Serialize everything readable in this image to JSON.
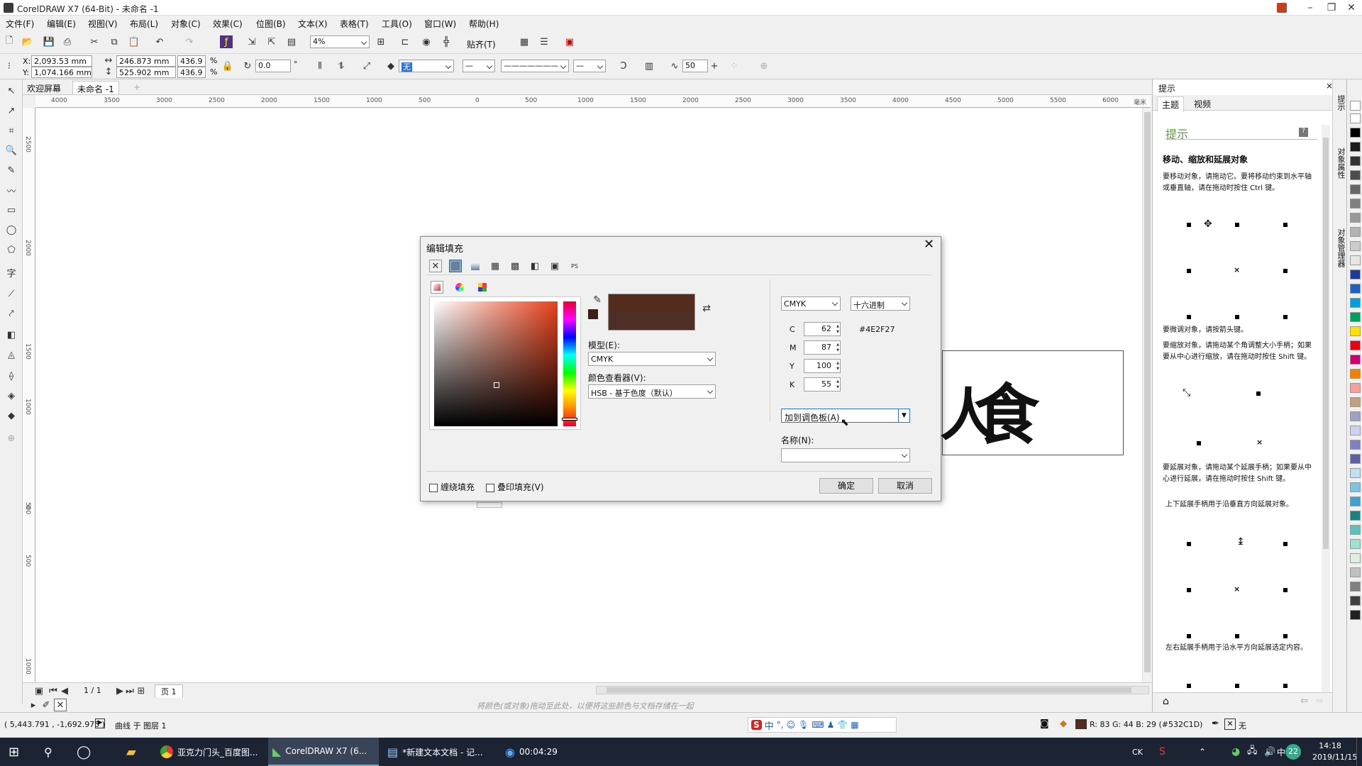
{
  "window": {
    "title": "CorelDRAW X7 (64-Bit) - 未命名 -1"
  },
  "menu": [
    "文件(F)",
    "编辑(E)",
    "视图(V)",
    "布局(L)",
    "对象(C)",
    "效果(C)",
    "位图(B)",
    "文本(X)",
    "表格(T)",
    "工具(O)",
    "窗口(W)",
    "帮助(H)"
  ],
  "toolbar": {
    "zoom": "4%",
    "snap": "贴齐(T)"
  },
  "propbar": {
    "x": "2,093.53 mm",
    "y": "1,074.166 mm",
    "w": "246.873 mm",
    "h": "525.902 mm",
    "sx": "436.9",
    "sy": "436.9",
    "pct": "%",
    "angle": "0.0",
    "deg": "°",
    "fill_none": "无",
    "smooth": "50"
  },
  "doc_tabs": [
    "欢迎屏幕",
    "未命名 -1"
  ],
  "ruler_h": [
    "4000",
    "3500",
    "3000",
    "2500",
    "2000",
    "1500",
    "1000",
    "500",
    "0",
    "500",
    "1000",
    "1500",
    "2000",
    "2500",
    "3000",
    "3500",
    "4000",
    "4500",
    "5000",
    "5500",
    "6000"
  ],
  "ruler_v": [
    "2500",
    "2000",
    "1500",
    "1000",
    "500",
    "0",
    "500",
    "1000"
  ],
  "ruler_unit": "毫米",
  "canvas": {
    "glyph": "食",
    "glyph_partial": "人"
  },
  "page_nav": {
    "counter": "1 / 1",
    "page_tab": "页 1"
  },
  "hint_text": "将颜色(或对象)拖动至此处，以便将这些颜色与文档存储在一起",
  "status": {
    "coords": "( 5,443.791 , -1,692.975 )",
    "layer": "曲线 于 图层 1",
    "color_info": "R: 83 G: 44 B: 29 (#532C1D)",
    "outline": "无"
  },
  "taskbar": {
    "items": [
      "亚克力门头_百度图...",
      "CorelDRAW X7 (6...",
      "*新建文本文档 - 记...",
      "00:04:29"
    ],
    "ime": "中",
    "time": "14:18",
    "date": "2019/11/15",
    "tray_num": "22",
    "tray_label": "CK"
  },
  "dialog": {
    "title": "编辑填充",
    "model_label": "模型(E):",
    "model_value": "CMYK",
    "viewer_label": "颜色查看器(V):",
    "viewer_value": "HSB - 基于色度（默认）",
    "color_model_dd": "CMYK",
    "hex_mode_dd": "十六进制",
    "hex_value": "#4E2F27",
    "c_label": "C",
    "c": "62",
    "m_label": "M",
    "m": "87",
    "y_label": "Y",
    "y": "100",
    "k_label": "K",
    "k": "55",
    "add_palette": "加到调色板(A)",
    "name_label": "名称(N):",
    "wrap_fill": "缠绕填充",
    "overprint_fill": "叠印填充(V)",
    "ok": "确定",
    "cancel": "取消",
    "swatch_color": "#4E2F27"
  },
  "docker": {
    "header": "提示",
    "tab_theme": "主题",
    "tab_video": "视频",
    "section": "提示",
    "heading": "移动、缩放和延展对象",
    "p1": "要移动对象，请拖动它。要将移动约束到水平轴或垂直轴，请在拖动时按住 Ctrl 键。",
    "p2": "要微调对象，请按箭头键。",
    "p3": "要缩放对象，请拖动某个角调整大小手柄；如果要从中心进行缩放，请在拖动时按住 Shift 键。",
    "p4": "要延展对象，请拖动某个延展手柄；如果要从中心进行延展，请在拖动时按住 Shift 键。",
    "p5": "上下延展手柄用于沿垂直方向延展对象。",
    "p6": "左右延展手柄用于沿水平方向延展选定内容。",
    "side_tabs": [
      "提示",
      "对象属性",
      "对象管理器"
    ]
  },
  "palette_colors": [
    "#ffffff",
    "#000000",
    "#1a1a1a",
    "#333333",
    "#4d4d4d",
    "#666666",
    "#808080",
    "#999999",
    "#b3b3b3",
    "#cccccc",
    "#e6e6e6",
    "#1f3a93",
    "#2060c0",
    "#00a0e0",
    "#00a060",
    "#ffe000",
    "#e60012",
    "#c8006e",
    "#f08000",
    "#f5a0a0",
    "#c0a080",
    "#a0a0c0",
    "#d0d0f0",
    "#8080c0",
    "#6060a0",
    "#c0e0f0",
    "#80c0e0",
    "#40a0d0",
    "#208080",
    "#60c0c0",
    "#a0e0d0",
    "#e0f0e0",
    "#c0c0c0",
    "#808080",
    "#404040",
    "#202020"
  ]
}
